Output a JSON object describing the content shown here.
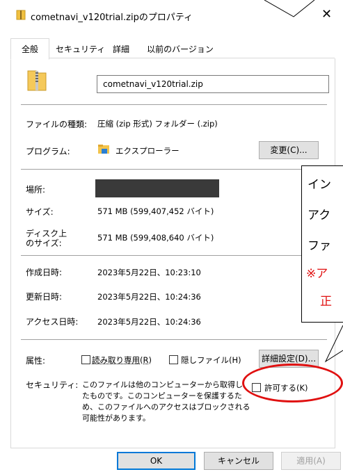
{
  "window": {
    "title": "cometnavi_v120trial.zipのプロパティ",
    "close_glyph": "✕"
  },
  "tabs": [
    {
      "label": "全般",
      "active": true
    },
    {
      "label": "セキュリティ",
      "active": false
    },
    {
      "label": "詳細",
      "active": false
    },
    {
      "label": "以前のバージョン",
      "active": false
    }
  ],
  "file": {
    "icon": "zip-folder-icon",
    "name": "cometnavi_v120trial.zip"
  },
  "type_row": {
    "label": "ファイルの種類:",
    "value": "圧縮 (zip 形式) フォルダー (.zip)"
  },
  "program_row": {
    "label": "プログラム:",
    "icon": "explorer-folder-icon",
    "value": "エクスプローラー",
    "change_button": "変更(C)..."
  },
  "location_row": {
    "label": "場所:"
  },
  "size_row": {
    "label": "サイズ:",
    "value": "571 MB (599,407,452 バイト)"
  },
  "disk_size_row": {
    "label_line1": "ディスク上",
    "label_line2": "のサイズ:",
    "value": "571 MB (599,408,640 バイト)"
  },
  "created_row": {
    "label": "作成日時:",
    "value": "2023年5月22日、10:23:10"
  },
  "modified_row": {
    "label": "更新日時:",
    "value": "2023年5月22日、10:24:36"
  },
  "accessed_row": {
    "label": "アクセス日時:",
    "value": "2023年5月22日、10:24:36"
  },
  "attributes": {
    "label": "属性:",
    "readonly_label": "読み取り専用(R)",
    "hidden_label": "隠しファイル(H)",
    "advanced_button": "詳細設定(D)..."
  },
  "security": {
    "label": "セキュリティ:",
    "text_line1": "このファイルは他のコンピューターから取得し",
    "text_line2": "たものです。このコンピューターを保護するた",
    "text_line3": "め、このファイルへのアクセスはブロックされる",
    "text_line4": "可能性があります。",
    "allow_label": "許可する(K)"
  },
  "footer": {
    "ok": "OK",
    "cancel": "キャンセル",
    "apply": "適用(A)"
  },
  "callout": {
    "line1": "イン",
    "line2": "アク",
    "line3": "ファ",
    "line4": "※ア",
    "line5": "正",
    "accent_color": "#e01010"
  }
}
